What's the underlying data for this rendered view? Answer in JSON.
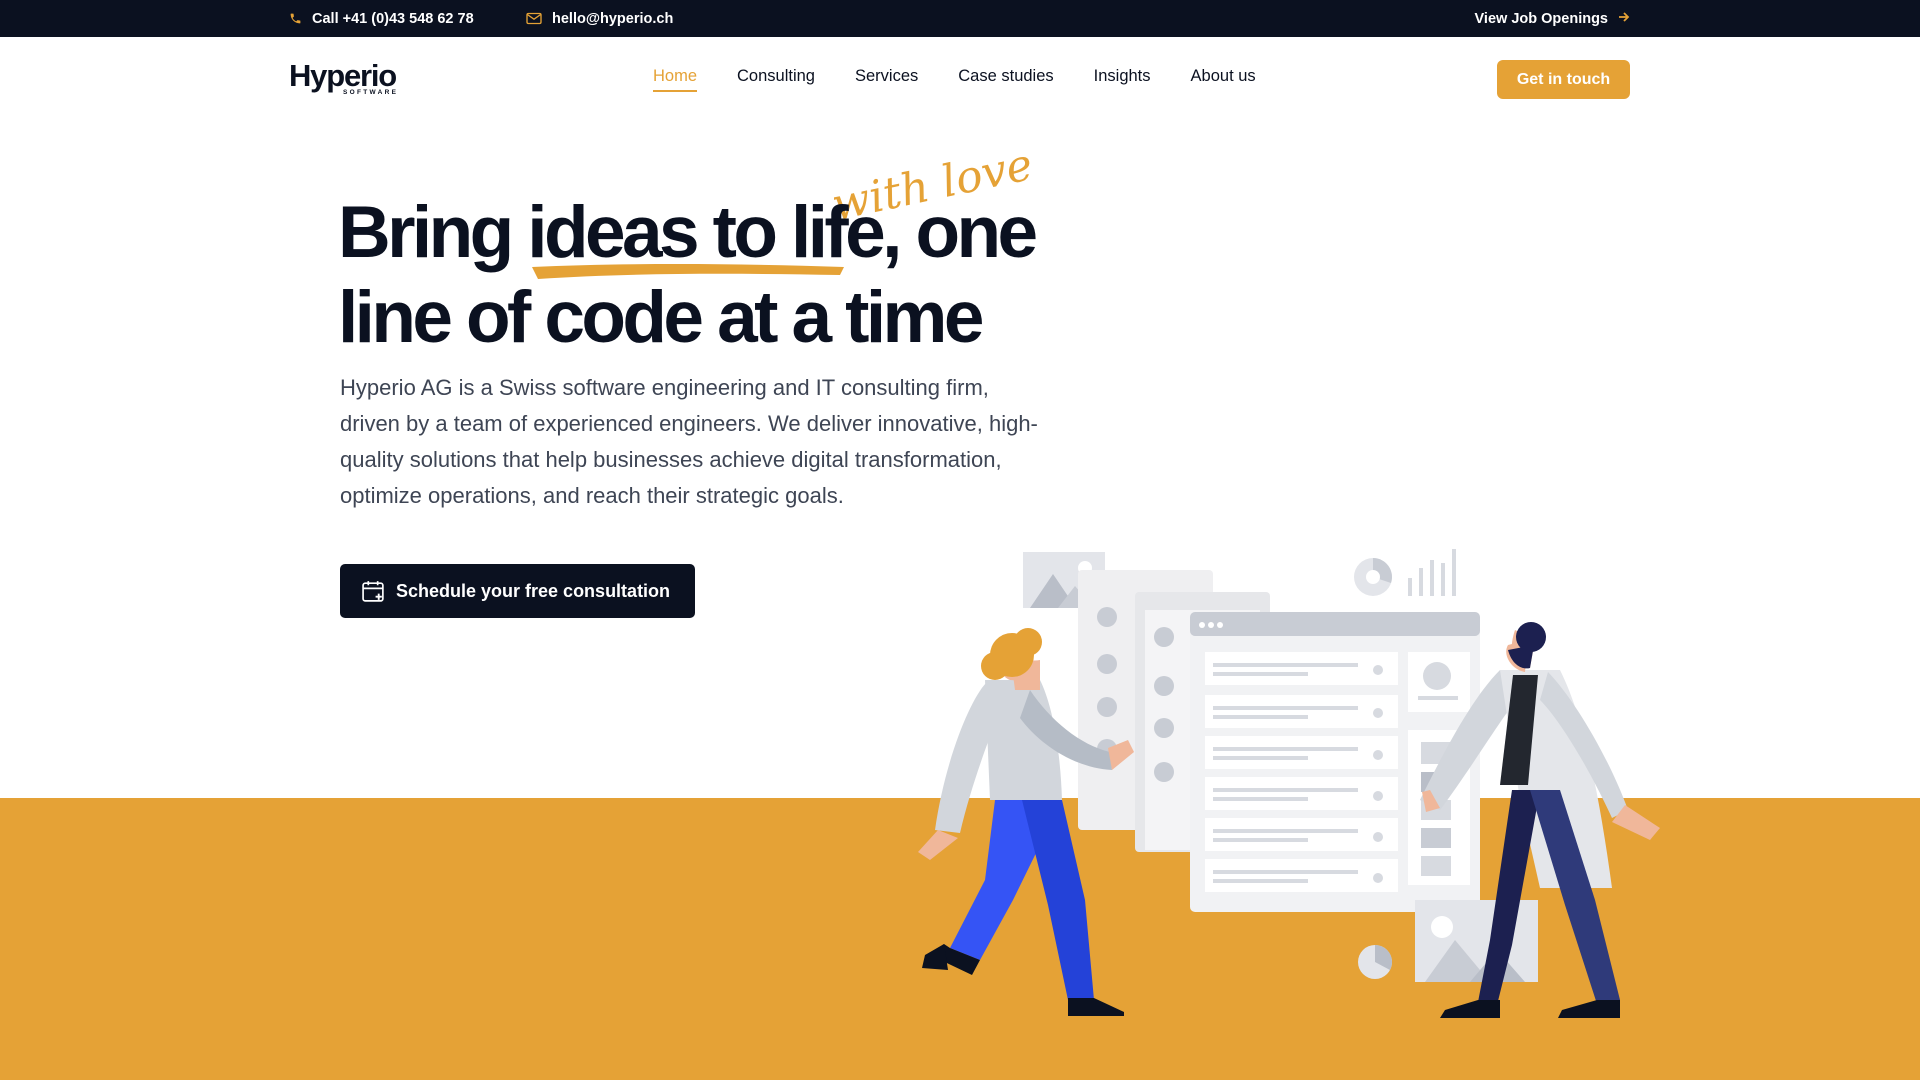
{
  "topbar": {
    "phone_label": "Call +41 (0)43 548 62 78",
    "email_label": "hello@hyperio.ch",
    "jobs_label": "View Job Openings"
  },
  "logo": {
    "word": "Hyperio",
    "sub": "SOFTWARE"
  },
  "nav": {
    "items": [
      {
        "label": "Home"
      },
      {
        "label": "Consulting"
      },
      {
        "label": "Services"
      },
      {
        "label": "Case studies"
      },
      {
        "label": "Insights"
      },
      {
        "label": "About us"
      }
    ],
    "active": "Home",
    "cta_label": "Get in touch"
  },
  "hero": {
    "script_text": "with love",
    "headline_part1": "Bring ",
    "headline_highlight": "ideas to life",
    "headline_part2": ", one line of code at a time",
    "lead": "Hyperio AG is a Swiss software engineering and IT consulting firm, driven by a team of experienced engineers. We deliver innovative, high-quality solutions that help businesses achieve digital transformation, optimize operations, and reach their strategic goals.",
    "schedule_label": "Schedule your free consultation"
  },
  "colors": {
    "accent": "#e5a236",
    "dark": "#0b1120",
    "text_muted": "#3e4554"
  },
  "icons": {
    "phone": "phone-icon",
    "email": "mail-icon",
    "arrow": "arrow-right-icon",
    "calendar": "calendar-plus-icon"
  }
}
